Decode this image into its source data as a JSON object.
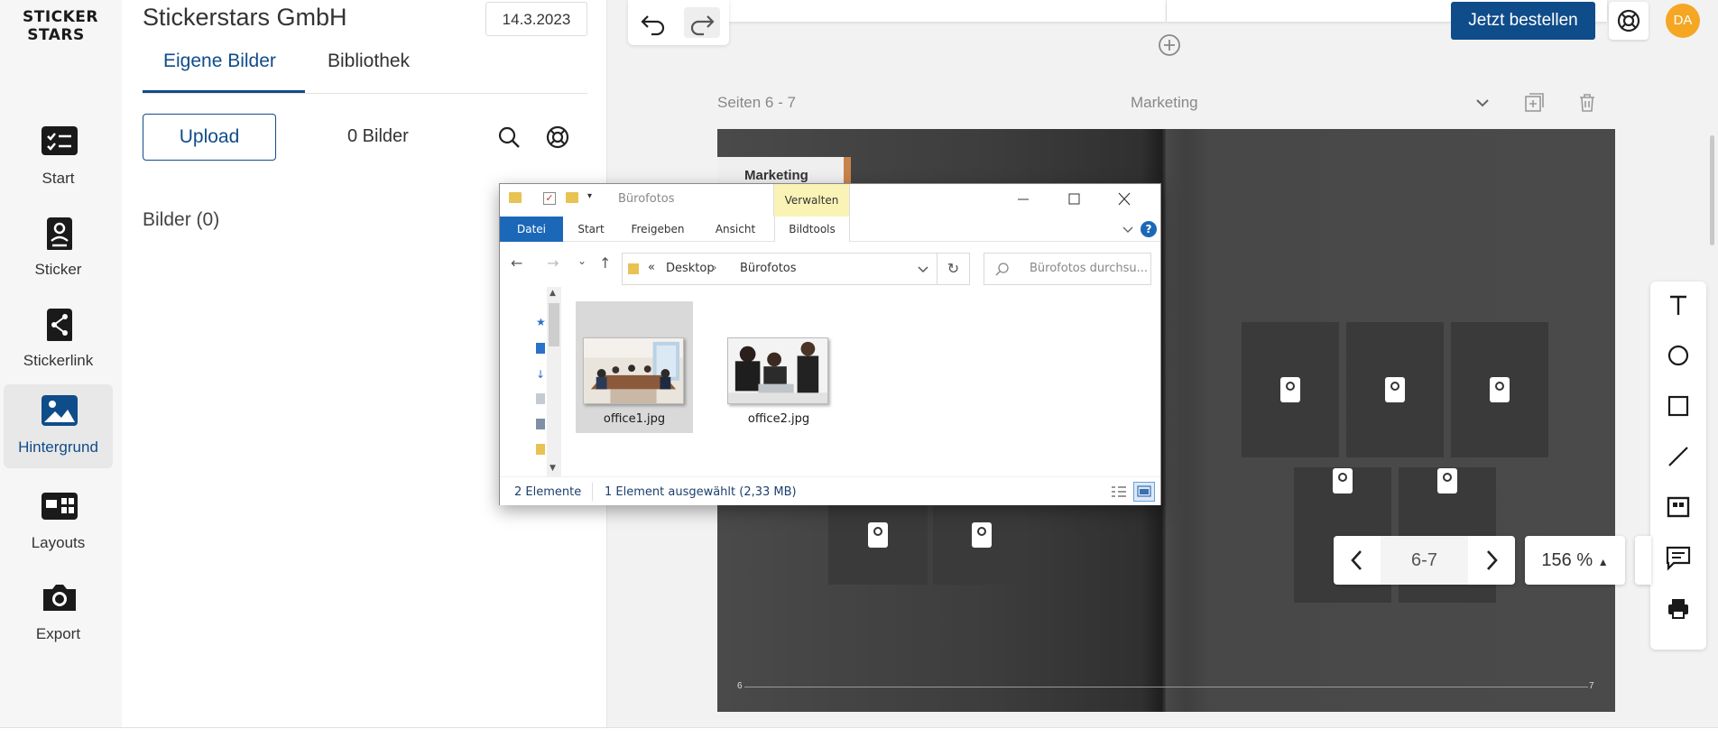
{
  "app": {
    "logo_text": "STICKER STARS",
    "order_button": "Jetzt bestellen",
    "avatar_initials": "DA",
    "accent_color": "#0f4c8a",
    "avatar_color": "#f5a623"
  },
  "nav": {
    "items": [
      {
        "label": "Start",
        "icon": "checklist-icon",
        "active": false
      },
      {
        "label": "Sticker",
        "icon": "sticker-icon",
        "active": false
      },
      {
        "label": "Stickerlink",
        "icon": "share-icon",
        "active": false
      },
      {
        "label": "Hintergrund",
        "icon": "image-icon",
        "active": true
      },
      {
        "label": "Layouts",
        "icon": "layouts-icon",
        "active": false
      },
      {
        "label": "Export",
        "icon": "camera-icon",
        "active": false
      }
    ]
  },
  "panel": {
    "company": "Stickerstars GmbH",
    "date": "14.3.2023",
    "tabs": [
      {
        "label": "Eigene Bilder",
        "active": true
      },
      {
        "label": "Bibliothek",
        "active": false
      }
    ],
    "upload_label": "Upload",
    "image_count": "0 Bilder",
    "images_heading": "Bilder (0)"
  },
  "editor": {
    "pages_label": "Seiten 6 - 7",
    "section": "Marketing",
    "marketing_tag": "Marketing",
    "page_left": "6",
    "page_right": "7",
    "pager_value": "6-7",
    "zoom": "156 %"
  },
  "tools": [
    "text-tool-icon",
    "circle-tool-icon",
    "rectangle-tool-icon",
    "line-tool-icon",
    "frame-tool-icon",
    "comment-tool-icon",
    "print-icon"
  ],
  "explorer": {
    "title": "Bürofotos",
    "manage_tab": "Verwalten",
    "ribbon_tabs": {
      "file": "Datei",
      "start": "Start",
      "share": "Freigeben",
      "view": "Ansicht",
      "picture_tools": "Bildtools"
    },
    "help": "?",
    "address": {
      "separator": "«",
      "desktop": "Desktop",
      "folder": "Bürofotos"
    },
    "search_placeholder": "Bürofotos durchsu...",
    "files": [
      {
        "name": "office1.jpg",
        "selected": true
      },
      {
        "name": "office2.jpg",
        "selected": false
      }
    ],
    "status_count": "2 Elemente",
    "status_selected": "1 Element ausgewählt (2,33 MB)"
  }
}
